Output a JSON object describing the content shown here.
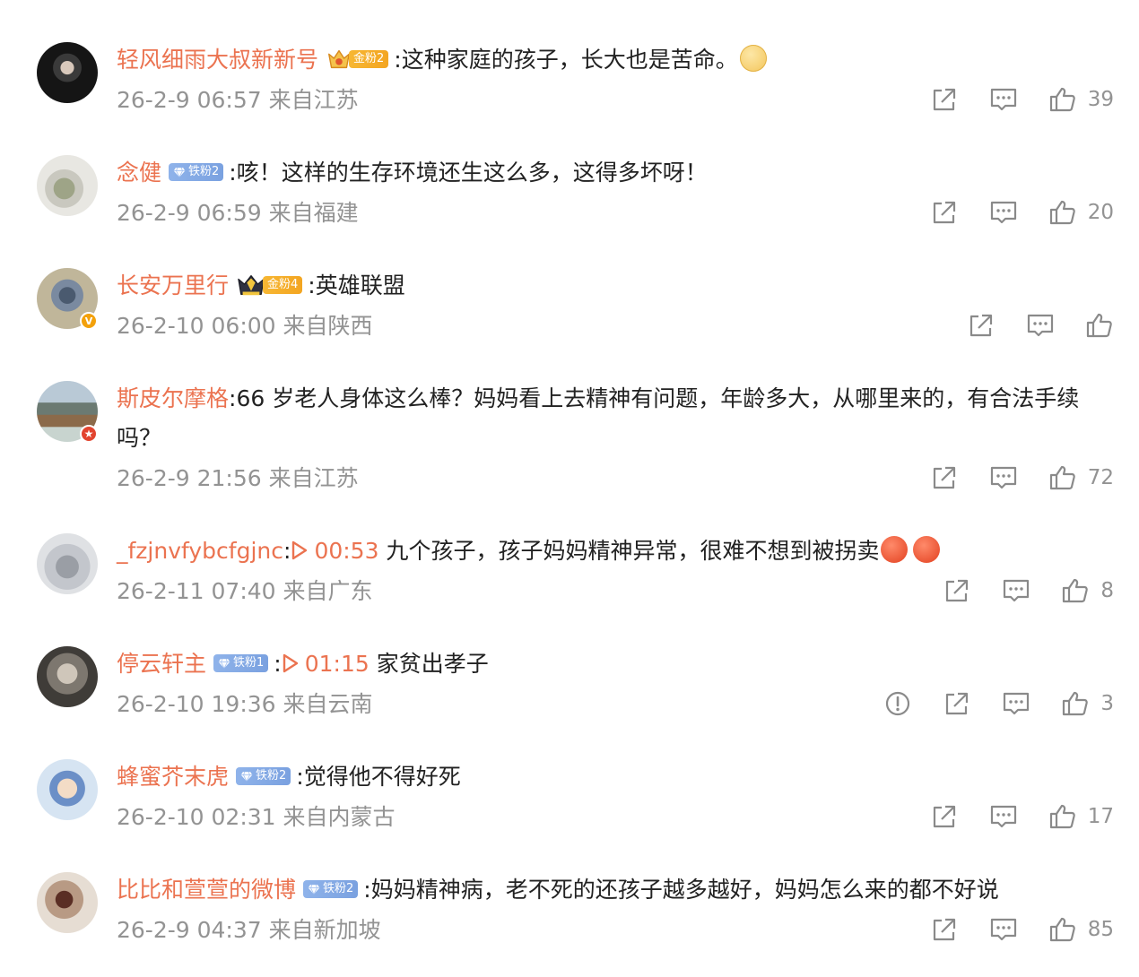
{
  "comments": [
    {
      "username": "轻风细雨大叔新新号",
      "badge": {
        "type": "gold",
        "label": "金粉2"
      },
      "text": "这种家庭的孩子，长大也是苦命。",
      "time": "26-2-9 06:57",
      "location": "来自江苏",
      "likes": "39",
      "emoji": "shush-emoji"
    },
    {
      "username": "念健",
      "badge": {
        "type": "iron",
        "label": "铁粉2"
      },
      "text": "咳！这样的生存环境还生这么多，这得多坏呀！",
      "time": "26-2-9 06:59",
      "location": "来自福建",
      "likes": "20"
    },
    {
      "username": "长安万里行",
      "badge": {
        "type": "gold",
        "label": "金粉4"
      },
      "text": "英雄联盟",
      "time": "26-2-10 06:00",
      "location": "来自陕西",
      "likes": ""
    },
    {
      "username": "斯皮尔摩格",
      "text": "66 岁老人身体这么棒？妈妈看上去精神有问题，年龄多大，从哪里来的，有合法手续吗？",
      "time": "26-2-9 21:56",
      "location": "来自江苏",
      "likes": "72"
    },
    {
      "username": "_fzjnvfybcfgjnc",
      "video_time": "00:53",
      "text": "九个孩子，孩子妈妈精神异常，很难不想到被拐卖",
      "time": "26-2-11 07:40",
      "location": "来自广东",
      "likes": "8",
      "emoji": "angry-emoji"
    },
    {
      "username": "停云轩主",
      "badge": {
        "type": "iron",
        "label": "铁粉1"
      },
      "video_time": "01:15",
      "text": "家贫出孝子",
      "time": "26-2-10 19:36",
      "location": "来自云南",
      "likes": "3"
    },
    {
      "username": "蜂蜜芥末虎",
      "badge": {
        "type": "iron",
        "label": "铁粉2"
      },
      "text": "觉得他不得好死",
      "time": "26-2-10 02:31",
      "location": "来自内蒙古",
      "likes": "17"
    },
    {
      "username": "比比和萱萱的微博",
      "badge": {
        "type": "iron",
        "label": "铁粉2"
      },
      "text": "妈妈精神病，老不死的还孩子越多越好，妈妈怎么来的都不好说",
      "time": "26-2-9 04:37",
      "location": "来自新加坡",
      "likes": "85"
    }
  ],
  "colors": {
    "username": "#eb7350",
    "meta": "#939393",
    "text": "#222222",
    "gold_badge": "#f7b733",
    "iron_badge": "#8fb3ea"
  }
}
